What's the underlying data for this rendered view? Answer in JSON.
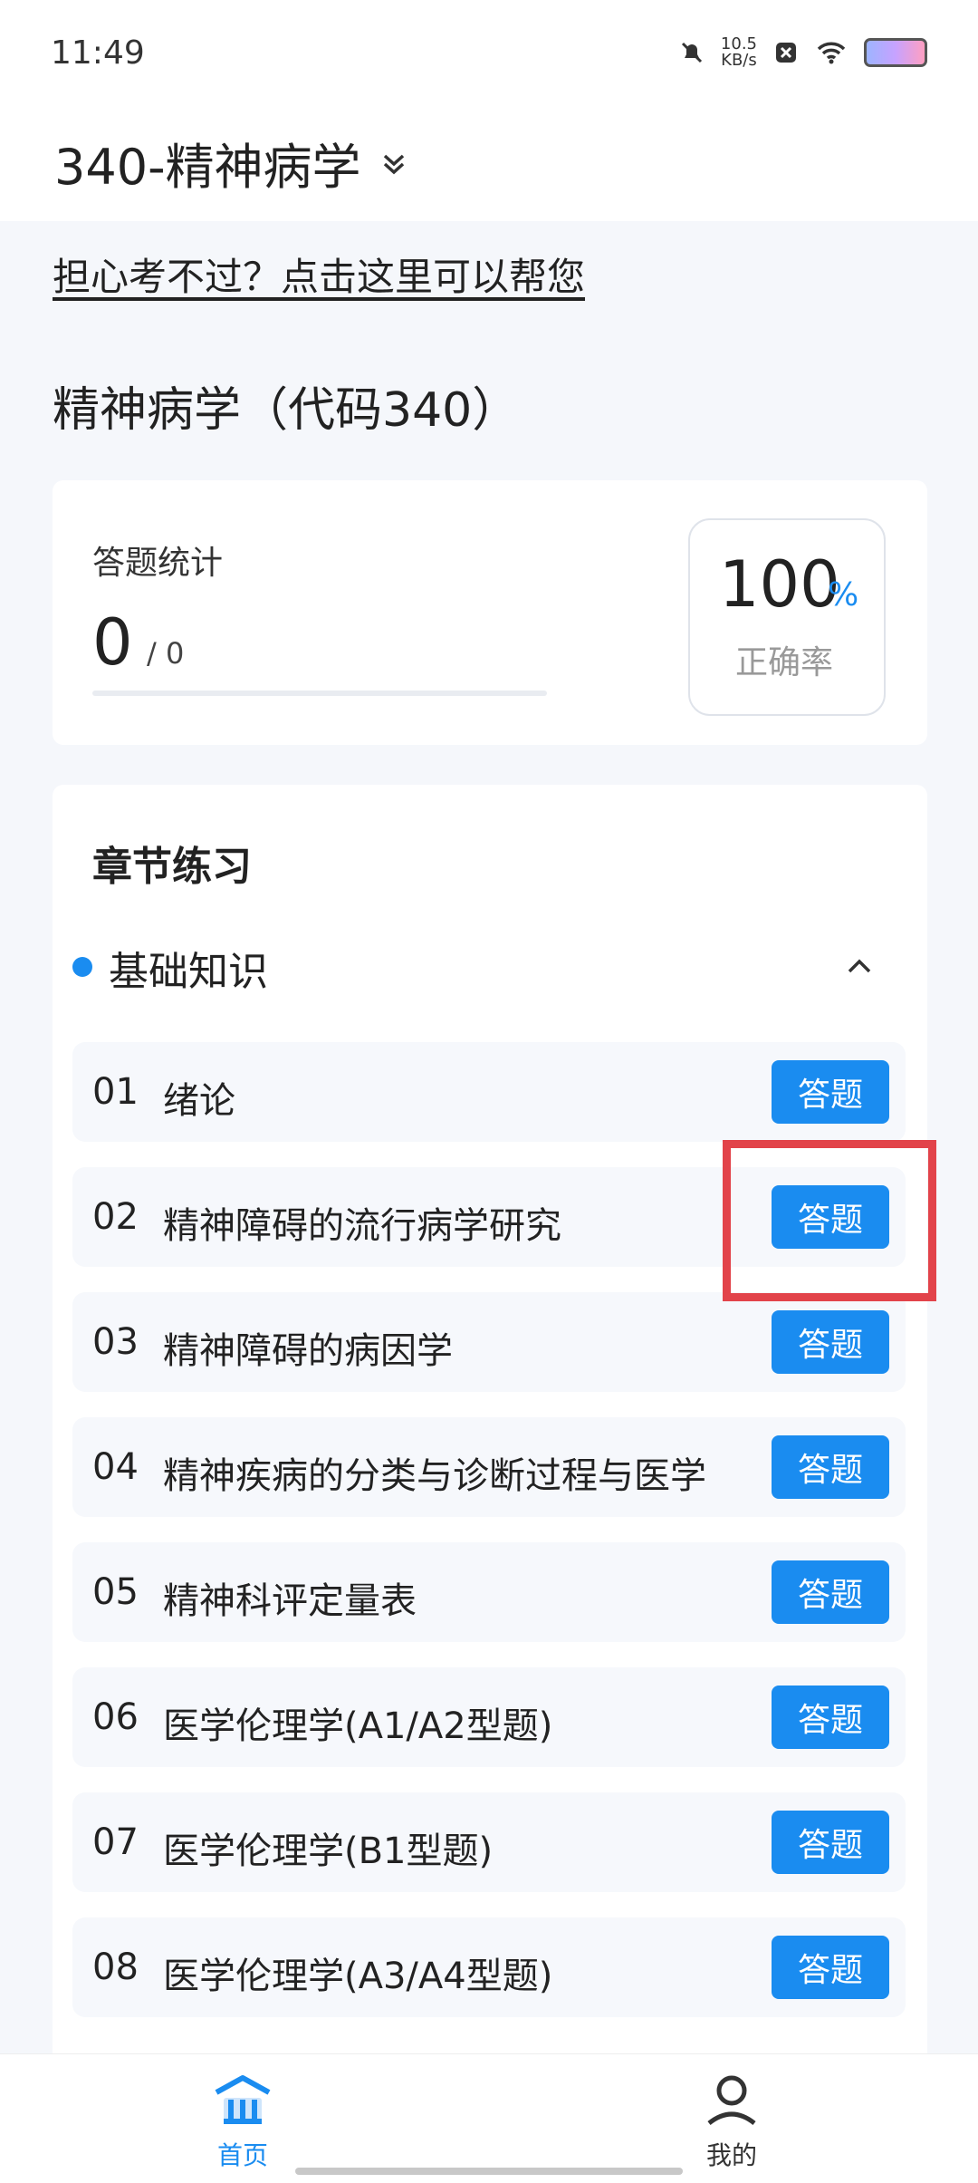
{
  "status": {
    "time": "11:49",
    "speed_value": "10.5",
    "speed_unit": "KB/s"
  },
  "header": {
    "title": "340-精神病学"
  },
  "help_link": "担心考不过？点击这里可以帮您",
  "subject_title": "精神病学（代码340）",
  "stats": {
    "label": "答题统计",
    "count": "0",
    "total": "/ 0",
    "progress_fraction": 0,
    "rate_value": "100",
    "rate_unit": "%",
    "rate_label": "正确率"
  },
  "chapters": {
    "title": "章节练习",
    "section": "基础知识",
    "button_label": "答题",
    "items": [
      {
        "num": "01",
        "name": "绪论"
      },
      {
        "num": "02",
        "name": "精神障碍的流行病学研究"
      },
      {
        "num": "03",
        "name": "精神障碍的病因学"
      },
      {
        "num": "04",
        "name": "精神疾病的分类与诊断过程与医学"
      },
      {
        "num": "05",
        "name": "精神科评定量表"
      },
      {
        "num": "06",
        "name": "医学伦理学(A1/A2型题)"
      },
      {
        "num": "07",
        "name": "医学伦理学(B1型题)"
      },
      {
        "num": "08",
        "name": "医学伦理学(A3/A4型题)"
      }
    ]
  },
  "nav": {
    "home": "首页",
    "me": "我的"
  },
  "colors": {
    "accent": "#1a8cf0",
    "highlight": "#e2434a"
  },
  "icons": [
    "silent-bell-icon",
    "close-box-icon",
    "wifi-icon",
    "battery-icon",
    "chevron-double-down-icon",
    "chevron-up-icon",
    "home-icon",
    "user-icon"
  ]
}
